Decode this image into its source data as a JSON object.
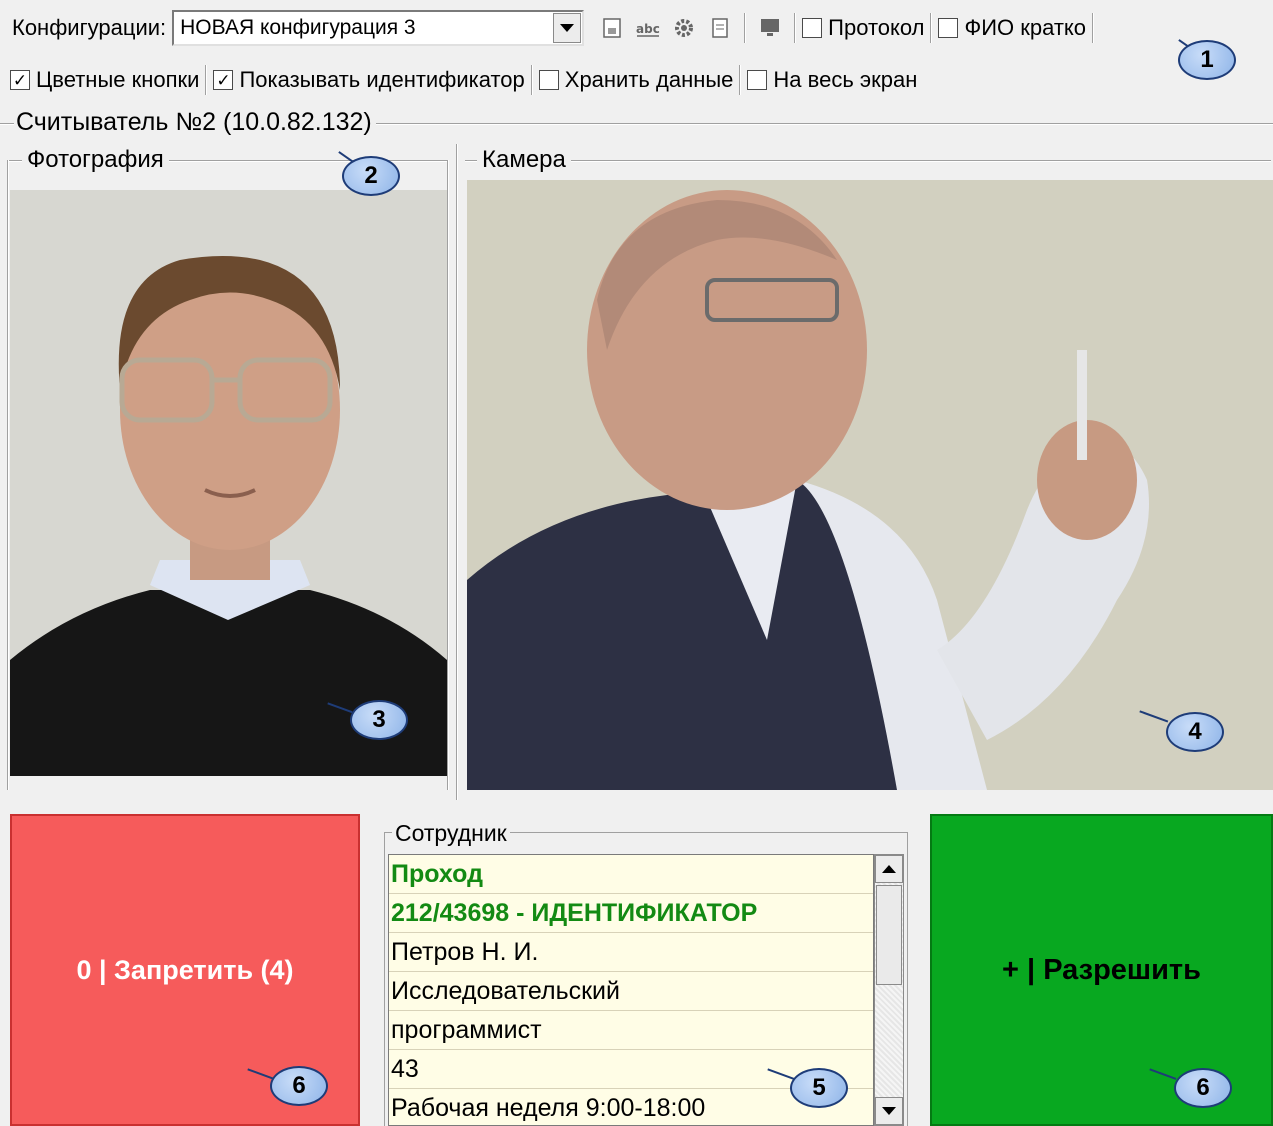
{
  "toolbar": {
    "configurations_label": "Конфигурации:",
    "configuration_value": "НОВАЯ конфигурация 3",
    "protocol_label": "Протокол",
    "protocol_checked": false,
    "fio_short_label": "ФИО кратко",
    "fio_short_checked": false,
    "color_buttons_label": "Цветные кнопки",
    "color_buttons_checked": true,
    "show_identifier_label": "Показывать идентификатор",
    "show_identifier_checked": true,
    "store_data_label": "Хранить данные",
    "store_data_checked": false,
    "fullscreen_label": "На весь экран",
    "fullscreen_checked": false,
    "check_mark": "✓",
    "icons": [
      "save-icon",
      "text-icon",
      "settings-icon",
      "document-icon",
      "monitor-icon"
    ]
  },
  "reader": {
    "title": "Считыватель №2 (10.0.82.132)"
  },
  "photo_panel": {
    "title": "Фотография"
  },
  "camera_panel": {
    "title": "Камера"
  },
  "deny_button": {
    "label": "0 | Запретить (4)",
    "color": "#f65b5b"
  },
  "allow_button": {
    "label": "+ | Разрешить",
    "color": "#08a820"
  },
  "employee": {
    "title": "Сотрудник",
    "rows": [
      "Проход",
      "212/43698 - ИДЕНТИФИКАТОР",
      "Петров Н. И.",
      "Исследовательский",
      "программист",
      "43",
      "Рабочая неделя 9:00-18:00"
    ],
    "highlight_color": "#138a13"
  },
  "callouts": [
    "1",
    "2",
    "3",
    "4",
    "5",
    "6",
    "6"
  ]
}
